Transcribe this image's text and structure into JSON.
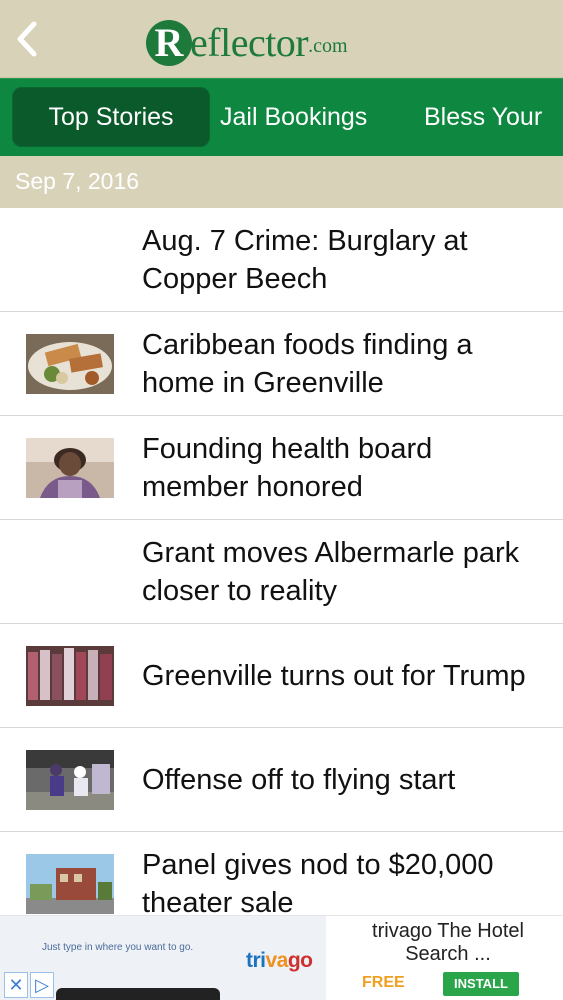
{
  "header": {
    "logo_r": "R",
    "logo_word": "eflector",
    "logo_suffix": ".com",
    "back_icon": "chevron-left-icon"
  },
  "tabs": [
    {
      "label": "Top Stories",
      "active": true
    },
    {
      "label": "Jail Bookings",
      "active": false
    },
    {
      "label": "Bless Your",
      "active": false
    }
  ],
  "date": "Sep 7, 2016",
  "articles": [
    {
      "headline": "Aug. 7 Crime: Burglary at Copper Beech",
      "has_thumbnail": false
    },
    {
      "headline": "Caribbean foods finding a home in Greenville",
      "has_thumbnail": true,
      "thumbnail": "food-plate-photo"
    },
    {
      "headline": "Founding health board member honored",
      "has_thumbnail": true,
      "thumbnail": "woman-portrait-photo"
    },
    {
      "headline": "Grant moves Albermarle park closer to reality",
      "has_thumbnail": false
    },
    {
      "headline": "Greenville turns out for Trump",
      "has_thumbnail": true,
      "thumbnail": "crowd-photo"
    },
    {
      "headline": "Offense off to flying start",
      "has_thumbnail": true,
      "thumbnail": "football-photo"
    },
    {
      "headline": "Panel gives nod to $20,000 theater sale",
      "has_thumbnail": true,
      "thumbnail": "theater-building-photo"
    }
  ],
  "ad": {
    "tagline": "Just type in where you want to go.",
    "brand": "trivago",
    "title": "trivago The Hotel Search ...",
    "price": "FREE",
    "install_label": "INSTALL",
    "close_icon": "close-icon",
    "adchoices_icon": "adchoices-icon"
  },
  "colors": {
    "header_bg": "#d8d2b9",
    "tab_bar": "#0e8740",
    "tab_active": "#0a5a2b",
    "brand_green": "#1d7a3b"
  }
}
